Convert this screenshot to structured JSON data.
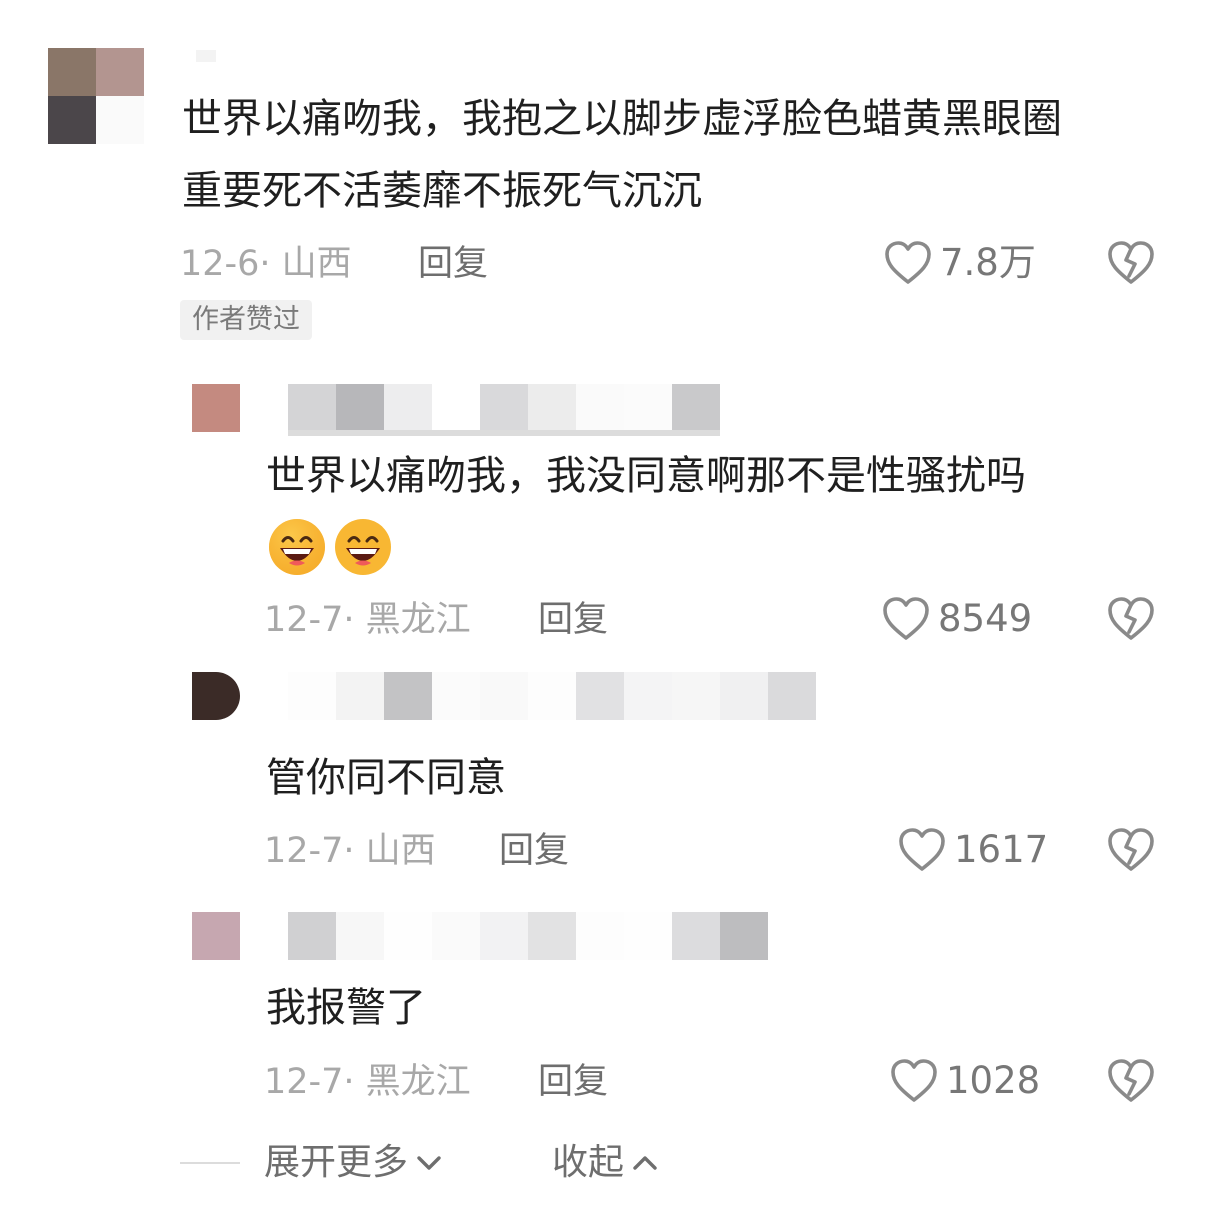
{
  "comments": [
    {
      "text_line1": "世界以痛吻我，我抱之以脚步虚浮脸色蜡黄黑眼圈",
      "text_line2": "重要死不活萎靡不振死气沉沉",
      "date_location": "12-6· 山西",
      "reply_label": "回复",
      "likes": "7.8万",
      "badge": "作者赞过"
    },
    {
      "text_line1": "世界以痛吻我，我没同意啊那不是性骚扰吗",
      "date_location": "12-7· 黑龙江",
      "reply_label": "回复",
      "likes": "8549",
      "emoji": "grinning-face-emoji"
    },
    {
      "text_line1": "管你同不同意",
      "date_location": "12-7· 山西",
      "reply_label": "回复",
      "likes": "1617"
    },
    {
      "text_line1": "我报警了",
      "date_location": "12-7· 黑龙江",
      "reply_label": "回复",
      "likes": "1028"
    }
  ],
  "footer": {
    "expand_label": "展开更多",
    "collapse_label": "收起"
  },
  "colors": {
    "meta_gray": "#a8a8a8",
    "text": "#1f1f1f",
    "icon_gray": "#8a8a8a"
  }
}
